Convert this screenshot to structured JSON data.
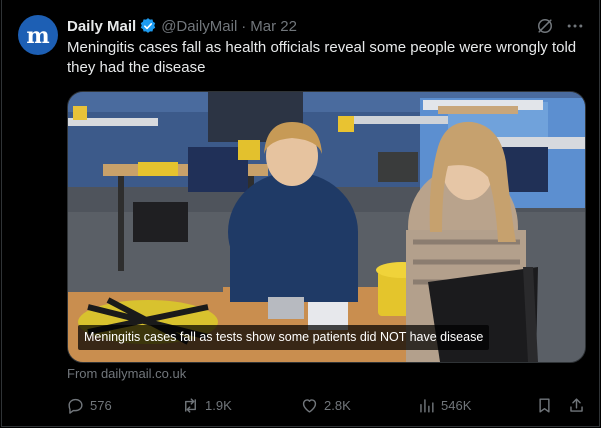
{
  "tweet": {
    "display_name": "Daily Mail",
    "handle": "@DailyMail",
    "separator": "·",
    "date": "Mar 22",
    "verified": true,
    "avatar_letter": "m",
    "avatar_icon": "daily-mail-logo",
    "text": "Meningitis cases fall as health officials reveal some people were wrongly told they had the disease",
    "media": {
      "caption": "Meningitis cases fall as tests show some patients did NOT have disease",
      "description_icon": "video-still"
    },
    "source": "From dailymail.co.uk"
  },
  "actions": {
    "replies": "576",
    "reposts": "1.9K",
    "likes": "2.8K",
    "views": "546K"
  },
  "icons": {
    "grok": "grok-icon",
    "more": "more-icon",
    "reply": "reply-icon",
    "repost": "repost-icon",
    "like": "like-icon",
    "views": "views-icon",
    "bookmark": "bookmark-icon",
    "share": "share-icon"
  },
  "colors": {
    "background": "#000000",
    "text": "#e7e9ea",
    "muted": "#71767b",
    "verified": "#1d9bf0",
    "avatar": "#1d5fb4"
  }
}
